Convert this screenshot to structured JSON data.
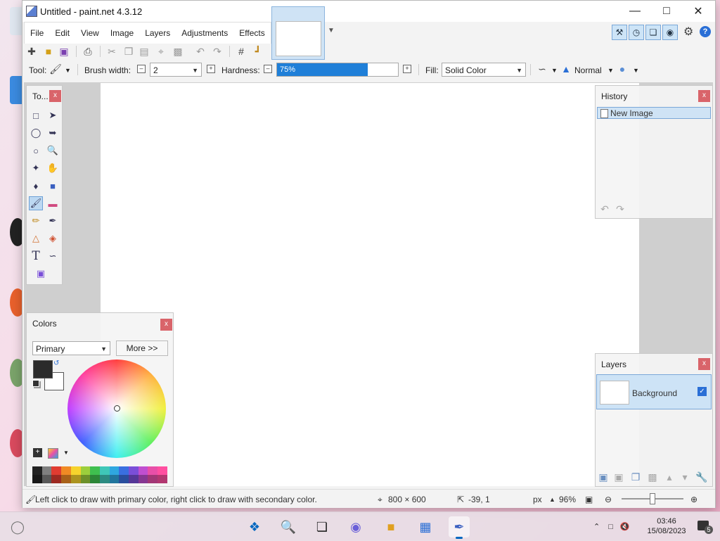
{
  "window": {
    "title": "Untitled - paint.net 4.3.12"
  },
  "menu": [
    "File",
    "Edit",
    "View",
    "Image",
    "Layers",
    "Adjustments",
    "Effects"
  ],
  "toolbar": {
    "tool_label": "Tool:",
    "brush_width_label": "Brush width:",
    "brush_width_value": "2",
    "hardness_label": "Hardness:",
    "hardness_value": "75%",
    "hardness_percent": 75,
    "fill_label": "Fill:",
    "fill_value": "Solid Color",
    "blend_mode": "Normal"
  },
  "tools_panel": {
    "title": "To..."
  },
  "history_panel": {
    "title": "History",
    "items": [
      "New Image"
    ]
  },
  "colors_panel": {
    "title": "Colors",
    "mode": "Primary",
    "more_label": "More >>"
  },
  "layers_panel": {
    "title": "Layers",
    "layers": [
      {
        "name": "Background",
        "visible": true
      }
    ]
  },
  "status": {
    "hint": "Left click to draw with primary color, right click to draw with secondary color.",
    "image_size": "800 × 600",
    "cursor_pos": "-39, 1",
    "units": "px",
    "zoom": "96%"
  },
  "taskbar": {
    "time": "03:46",
    "date": "15/08/2023",
    "notifications": "5"
  },
  "colors": {
    "accent": "#1f7fd8",
    "close": "#d9646a",
    "palette": [
      "#222222",
      "#7f7f7f",
      "#e03c31",
      "#f08a24",
      "#f6d32d",
      "#9ccf3c",
      "#3fbf4f",
      "#3fc7b8",
      "#2fa7e0",
      "#3a6fe0",
      "#7a4fd8",
      "#c04fd0",
      "#e84fa8",
      "#ff4fa0"
    ]
  }
}
